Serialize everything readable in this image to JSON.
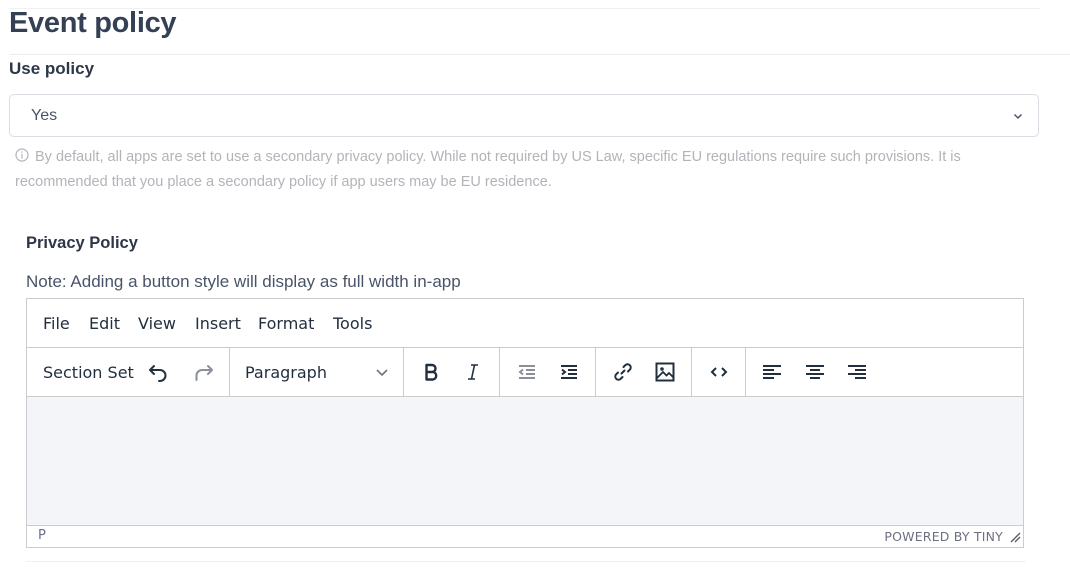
{
  "page": {
    "title": "Event policy"
  },
  "use_policy": {
    "label": "Use policy",
    "selected": "Yes",
    "help_icon": "info-circle-icon",
    "help_text": "By default, all apps are set to use a secondary privacy policy. While not required by US Law, specific EU regulations require such provisions. It is recommended that you place a secondary policy if app users may be EU residence."
  },
  "privacy_policy": {
    "label": "Privacy Policy",
    "note": "Note: Adding a button style will display as full width in-app"
  },
  "editor": {
    "menu": [
      "File",
      "Edit",
      "View",
      "Insert",
      "Format",
      "Tools"
    ],
    "toolbar": {
      "section_set": "Section Set",
      "undo_icon": "undo-icon",
      "redo_icon": "redo-icon",
      "block_format": "Paragraph",
      "icons": [
        "bold-icon",
        "italic-icon",
        "outdent-icon",
        "indent-icon",
        "link-icon",
        "image-icon",
        "code-icon",
        "align-left-icon",
        "align-center-icon",
        "align-right-icon"
      ]
    },
    "content": "",
    "status_path": "P",
    "branding": "POWERED BY TINY"
  },
  "colors": {
    "text_dark": "#344054",
    "help_text": "#b3b3ba",
    "editor_bg": "#f4f5f8",
    "icon": "#222f3e",
    "icon_disabled": "#8a8f99"
  }
}
